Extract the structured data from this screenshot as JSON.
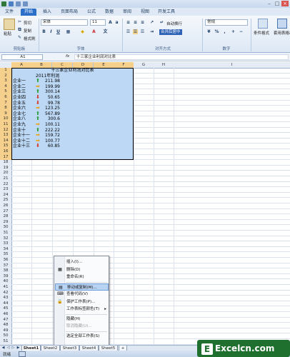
{
  "ribbon": {
    "tabs": [
      "文件",
      "开始",
      "插入",
      "页面布局",
      "公式",
      "数据",
      "审阅",
      "视图",
      "开发工具"
    ],
    "active_tab": "开始",
    "clipboard": {
      "paste": "粘贴",
      "cut": "剪切",
      "copy": "复制",
      "painter": "格式刷",
      "group": "剪贴板"
    },
    "font": {
      "name": "宋体",
      "size": "11",
      "group": "字体"
    },
    "alignment": {
      "wrap": "自动换行",
      "merge": "合并后居中",
      "group": "对齐方式"
    },
    "number": {
      "format": "常规",
      "group": "数字"
    },
    "styles": {
      "conditional": "条件格式",
      "table": "套用表格格式"
    }
  },
  "formula_bar": {
    "name_box": "A1",
    "fx": "fx",
    "content": "十三家企业利润对比表"
  },
  "columns": [
    "A",
    "B",
    "C",
    "D",
    "E",
    "F",
    "G",
    "H",
    "I"
  ],
  "table": {
    "title": "十三家企业利润对比表",
    "subtitle": "2011年利润",
    "rows": [
      {
        "name": "企业一",
        "value": "211.98",
        "trend": "up"
      },
      {
        "name": "企业二",
        "value": "199.99",
        "trend": "side"
      },
      {
        "name": "企业三",
        "value": "300.14",
        "trend": "up"
      },
      {
        "name": "企业四",
        "value": "50.65",
        "trend": "down"
      },
      {
        "name": "企业五",
        "value": "99.78",
        "trend": "down"
      },
      {
        "name": "企业六",
        "value": "123.25",
        "trend": "side"
      },
      {
        "name": "企业七",
        "value": "567.89",
        "trend": "up"
      },
      {
        "name": "企业八",
        "value": "300.6",
        "trend": "up"
      },
      {
        "name": "企业九",
        "value": "100.11",
        "trend": "side"
      },
      {
        "name": "企业十",
        "value": "222.22",
        "trend": "up"
      },
      {
        "name": "企业十一",
        "value": "159.72",
        "trend": "side"
      },
      {
        "name": "企业十二",
        "value": "100.77",
        "trend": "side"
      },
      {
        "name": "企业十三",
        "value": "60.85",
        "trend": "down"
      }
    ]
  },
  "row_numbers": [
    "1",
    "2",
    "3",
    "4",
    "5",
    "6",
    "7",
    "8",
    "9",
    "10",
    "11",
    "12",
    "13",
    "14",
    "15",
    "16",
    "17",
    "18",
    "19",
    "20",
    "21",
    "22",
    "23",
    "24",
    "25",
    "26",
    "27",
    "28",
    "29",
    "30",
    "31",
    "32",
    "33",
    "34",
    "35",
    "36",
    "37",
    "38",
    "39",
    "40",
    "41",
    "42",
    "43",
    "44",
    "45",
    "46",
    "47",
    "48",
    "49",
    "50",
    "51"
  ],
  "context_menu": {
    "items": [
      {
        "label": "插入(I)...",
        "disabled": false
      },
      {
        "label": "删除(D)",
        "disabled": false
      },
      {
        "label": "重命名(R)",
        "disabled": false
      },
      {
        "label": "移动或复制(M)...",
        "disabled": false,
        "highlight": true
      },
      {
        "label": "查看代码(V)",
        "disabled": false
      },
      {
        "label": "保护工作表(P)...",
        "disabled": false
      },
      {
        "label": "工作表标签颜色(T)",
        "disabled": false,
        "submenu": true
      },
      {
        "label": "隐藏(H)",
        "disabled": false
      },
      {
        "label": "取消隐藏(U)...",
        "disabled": true
      },
      {
        "label": "选定全部工作表(S)",
        "disabled": false
      }
    ]
  },
  "sheet_tabs": [
    "Sheet1",
    "Sheet2",
    "Sheet3",
    "Sheet4",
    "Sheet5"
  ],
  "status": {
    "mode": "就绪"
  },
  "watermark": {
    "logo": "E",
    "text": "Excelcn.com"
  },
  "colors": {
    "up": "#2e9e3a",
    "side": "#e8a317",
    "down": "#d63a2f",
    "selection": "#bcd8f5",
    "accent": "#2c6fc9"
  }
}
